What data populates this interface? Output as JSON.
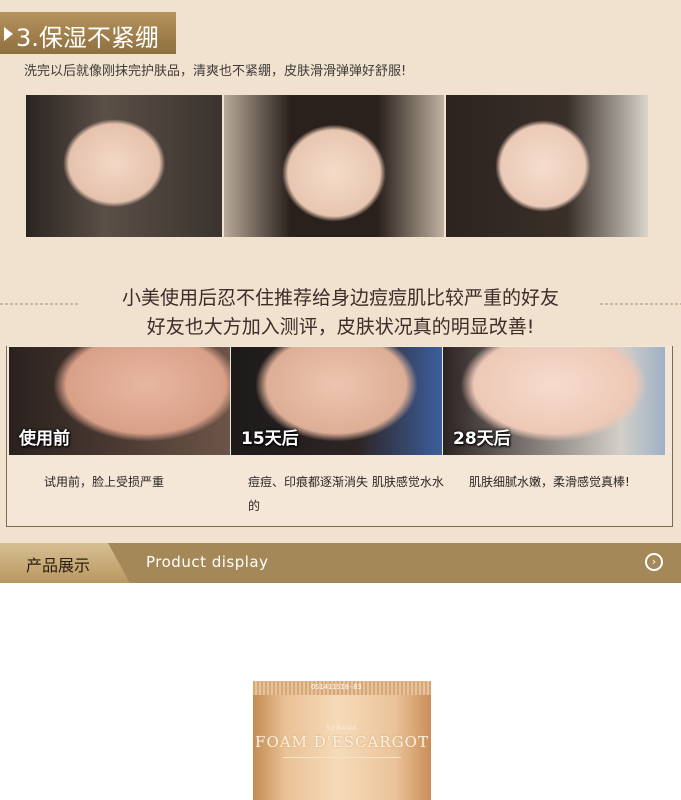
{
  "section": {
    "number_title": "3.保湿不紧绷",
    "subtitle": "洗完以后就像刚抹完护肤品，清爽也不紧绷，皮肤滑滑弹弹好舒服!"
  },
  "recommendation": {
    "line1": "小美使用后忍不住推荐给身边痘痘肌比较严重的好友",
    "line2": "好友也大方加入测评，皮肤状况真的明显改善!"
  },
  "comparison": {
    "stages": [
      "使用前",
      "15天后",
      "28天后"
    ],
    "captions": [
      "试用前，脸上受损严重",
      "痘痘、印痕都逐渐消失 肌肤感觉水水的",
      "肌肤细腻水嫩，柔滑感觉真棒!"
    ]
  },
  "product_band": {
    "title_cn": "产品展示",
    "title_en": "Product display"
  },
  "product": {
    "code": "OS1411SI8-83",
    "brand": "SENANA",
    "name": "FOAM D'ESCARGOT"
  },
  "colors": {
    "background": "#f1e2d0",
    "gold": "#a58858",
    "text_dark": "#3c2c2a"
  },
  "icons": [
    "play-triangle-icon",
    "arrow-circle-icon"
  ]
}
